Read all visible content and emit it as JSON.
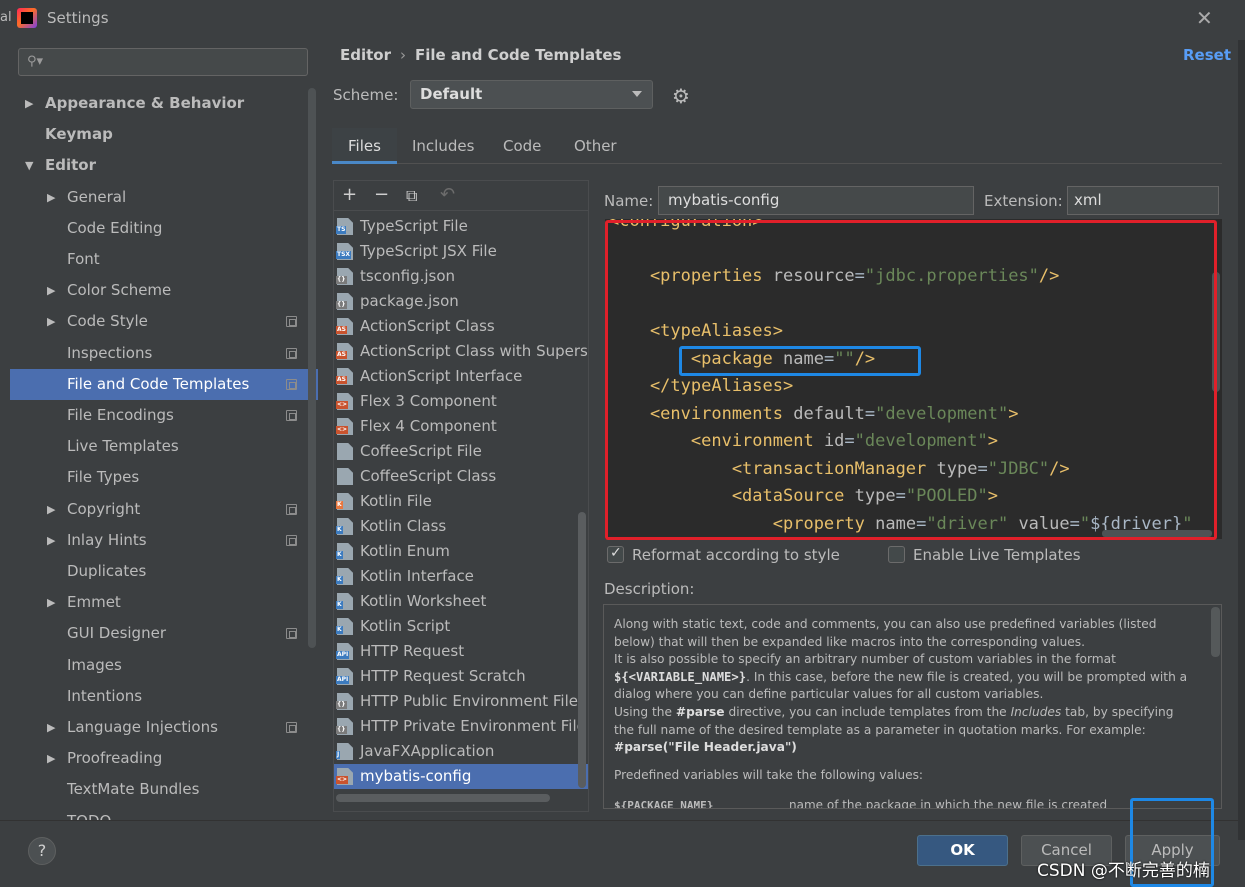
{
  "window": {
    "title": "Settings",
    "left_fragment": "al",
    "close_glyph": "✕"
  },
  "sidebar": {
    "search_placeholder": "",
    "items": [
      {
        "label": "Appearance & Behavior",
        "level": 0,
        "arrow": "▶",
        "bold": true
      },
      {
        "label": "Keymap",
        "level": 0,
        "arrow": "",
        "bold": true
      },
      {
        "label": "Editor",
        "level": 0,
        "arrow": "▼",
        "bold": true
      },
      {
        "label": "General",
        "level": 1,
        "arrow": "▶"
      },
      {
        "label": "Code Editing",
        "level": 1,
        "arrow": ""
      },
      {
        "label": "Font",
        "level": 1,
        "arrow": ""
      },
      {
        "label": "Color Scheme",
        "level": 1,
        "arrow": "▶"
      },
      {
        "label": "Code Style",
        "level": 1,
        "arrow": "▶",
        "project": true
      },
      {
        "label": "Inspections",
        "level": 1,
        "arrow": "",
        "project": true
      },
      {
        "label": "File and Code Templates",
        "level": 1,
        "arrow": "",
        "project": true,
        "selected": true
      },
      {
        "label": "File Encodings",
        "level": 1,
        "arrow": "",
        "project": true
      },
      {
        "label": "Live Templates",
        "level": 1,
        "arrow": ""
      },
      {
        "label": "File Types",
        "level": 1,
        "arrow": ""
      },
      {
        "label": "Copyright",
        "level": 1,
        "arrow": "▶",
        "project": true
      },
      {
        "label": "Inlay Hints",
        "level": 1,
        "arrow": "▶",
        "project": true
      },
      {
        "label": "Duplicates",
        "level": 1,
        "arrow": ""
      },
      {
        "label": "Emmet",
        "level": 1,
        "arrow": "▶"
      },
      {
        "label": "GUI Designer",
        "level": 1,
        "arrow": "",
        "project": true
      },
      {
        "label": "Images",
        "level": 1,
        "arrow": ""
      },
      {
        "label": "Intentions",
        "level": 1,
        "arrow": ""
      },
      {
        "label": "Language Injections",
        "level": 1,
        "arrow": "▶",
        "project": true
      },
      {
        "label": "Proofreading",
        "level": 1,
        "arrow": "▶"
      },
      {
        "label": "TextMate Bundles",
        "level": 1,
        "arrow": ""
      },
      {
        "label": "TODO",
        "level": 1,
        "arrow": ""
      }
    ]
  },
  "header": {
    "breadcrumb_root": "Editor",
    "breadcrumb_sep": "›",
    "breadcrumb_page": "File and Code Templates",
    "reset_label": "Reset"
  },
  "scheme": {
    "label": "Scheme:",
    "value": "Default"
  },
  "tabs": [
    "Files",
    "Includes",
    "Code",
    "Other"
  ],
  "toolbar": {
    "add": "+",
    "remove": "−",
    "copy": "⧉",
    "undo": "↶"
  },
  "files": [
    {
      "label": "TypeScript File",
      "badge": "TS",
      "color": "#3c7bbf"
    },
    {
      "label": "TypeScript JSX File",
      "badge": "TSX",
      "color": "#3c7bbf"
    },
    {
      "label": "tsconfig.json",
      "badge": "{}",
      "color": "#7a7a7a"
    },
    {
      "label": "package.json",
      "badge": "{}",
      "color": "#7a7a7a"
    },
    {
      "label": "ActionScript Class",
      "badge": "AS",
      "color": "#c9532e"
    },
    {
      "label": "ActionScript Class with Supers",
      "badge": "AS",
      "color": "#c9532e"
    },
    {
      "label": "ActionScript Interface",
      "badge": "AS",
      "color": "#c9532e"
    },
    {
      "label": "Flex 3 Component",
      "badge": "<>",
      "color": "#c9532e"
    },
    {
      "label": "Flex 4 Component",
      "badge": "<>",
      "color": "#c9532e"
    },
    {
      "label": "CoffeeScript File",
      "badge": "",
      "color": "#3c8fd6"
    },
    {
      "label": "CoffeeScript Class",
      "badge": "",
      "color": "#3c8fd6"
    },
    {
      "label": "Kotlin File",
      "badge": "K",
      "color": "#e8773f"
    },
    {
      "label": "Kotlin Class",
      "badge": "K",
      "color": "#3c7bbf"
    },
    {
      "label": "Kotlin Enum",
      "badge": "K",
      "color": "#3c7bbf"
    },
    {
      "label": "Kotlin Interface",
      "badge": "K",
      "color": "#3c7bbf"
    },
    {
      "label": "Kotlin Worksheet",
      "badge": "K",
      "color": "#3c7bbf"
    },
    {
      "label": "Kotlin Script",
      "badge": "K",
      "color": "#3c7bbf"
    },
    {
      "label": "HTTP Request",
      "badge": "API",
      "color": "#3c7bbf"
    },
    {
      "label": "HTTP Request Scratch",
      "badge": "API",
      "color": "#3c7bbf"
    },
    {
      "label": "HTTP Public Environment File",
      "badge": "{}",
      "color": "#7a7a7a"
    },
    {
      "label": "HTTP Private Environment File",
      "badge": "{}",
      "color": "#7a7a7a"
    },
    {
      "label": "JavaFXApplication",
      "badge": "J",
      "color": "#3c7bbf"
    },
    {
      "label": "mybatis-config",
      "badge": "<>",
      "color": "#c9532e",
      "selected": true
    }
  ],
  "template": {
    "name_label": "Name:",
    "name_value": "mybatis-config",
    "extension_label": "Extension:",
    "extension_value": "xml"
  },
  "code_lines": [
    [
      {
        "c": "t",
        "s": "<configuration>"
      }
    ],
    [],
    [
      {
        "c": "t",
        "s": "    <properties "
      },
      {
        "c": "a",
        "s": "resource"
      },
      {
        "c": "p",
        "s": "="
      },
      {
        "c": "v",
        "s": "\"jdbc.properties\""
      },
      {
        "c": "t",
        "s": "/>"
      }
    ],
    [],
    [
      {
        "c": "t",
        "s": "    <typeAliases>"
      }
    ],
    [
      {
        "c": "t",
        "s": "        <package "
      },
      {
        "c": "a",
        "s": "name"
      },
      {
        "c": "p",
        "s": "="
      },
      {
        "c": "v",
        "s": "\"\""
      },
      {
        "c": "t",
        "s": "/>"
      }
    ],
    [
      {
        "c": "t",
        "s": "    </typeAliases>"
      }
    ],
    [
      {
        "c": "t",
        "s": "    <environments "
      },
      {
        "c": "a",
        "s": "default"
      },
      {
        "c": "p",
        "s": "="
      },
      {
        "c": "v",
        "s": "\"development\""
      },
      {
        "c": "t",
        "s": ">"
      }
    ],
    [
      {
        "c": "t",
        "s": "        <environment "
      },
      {
        "c": "a",
        "s": "id"
      },
      {
        "c": "p",
        "s": "="
      },
      {
        "c": "v",
        "s": "\"development\""
      },
      {
        "c": "t",
        "s": ">"
      }
    ],
    [
      {
        "c": "t",
        "s": "            <transactionManager "
      },
      {
        "c": "a",
        "s": "type"
      },
      {
        "c": "p",
        "s": "="
      },
      {
        "c": "v",
        "s": "\"JDBC\""
      },
      {
        "c": "t",
        "s": "/>"
      }
    ],
    [
      {
        "c": "t",
        "s": "            <dataSource "
      },
      {
        "c": "a",
        "s": "type"
      },
      {
        "c": "p",
        "s": "="
      },
      {
        "c": "v",
        "s": "\"POOLED\""
      },
      {
        "c": "t",
        "s": ">"
      }
    ],
    [
      {
        "c": "t",
        "s": "                <property "
      },
      {
        "c": "a",
        "s": "name"
      },
      {
        "c": "p",
        "s": "="
      },
      {
        "c": "v",
        "s": "\"driver\" "
      },
      {
        "c": "a",
        "s": "value"
      },
      {
        "c": "p",
        "s": "="
      },
      {
        "c": "v",
        "s": "\""
      },
      {
        "c": "p",
        "s": "${driver}"
      },
      {
        "c": "v",
        "s": "\""
      }
    ]
  ],
  "options": {
    "reformat_label": "Reformat according to style",
    "reformat_checked": true,
    "live_label": "Enable Live Templates",
    "live_checked": false
  },
  "description": {
    "label": "Description:",
    "p1": "Along with static text, code and comments, you can also use predefined variables (listed below) that will then be expanded like macros into the corresponding values.",
    "p2a": "It is also possible to specify an arbitrary number of custom variables in the format ",
    "p2b": "${<VARIABLE_NAME>}",
    "p2c": ". In this case, before the new file is created, you will be prompted with a dialog where you can define particular values for all custom variables.",
    "p3a": "Using the ",
    "p3b": "#parse",
    "p3c": " directive, you can include templates from the ",
    "p3d": "Includes",
    "p3e": " tab, by specifying the full name of the desired template as a parameter in quotation marks. For example:",
    "p3f": "#parse(\"File Header.java\")",
    "p4": "Predefined variables will take the following values:",
    "tail_var": "${PACKAGE_NAME}",
    "tail_desc": "name of the package in which the new file is created"
  },
  "buttons": {
    "help": "?",
    "ok": "OK",
    "cancel": "Cancel",
    "apply": "Apply"
  },
  "watermark": "CSDN @不断完善的楠"
}
